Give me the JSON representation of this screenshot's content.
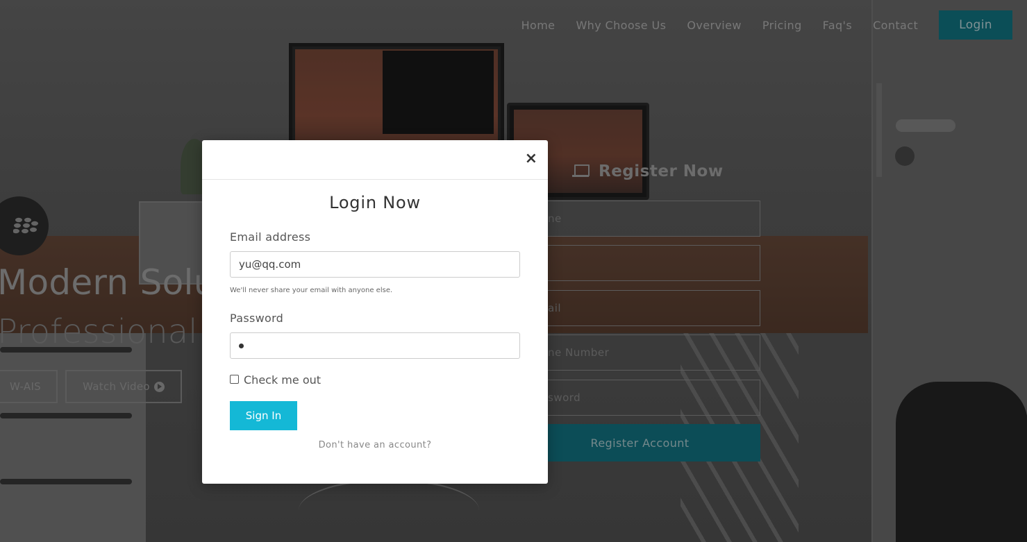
{
  "nav": {
    "items": [
      "Home",
      "Why Choose Us",
      "Overview",
      "Pricing",
      "Faq's",
      "Contact"
    ],
    "login_label": "Login"
  },
  "hero": {
    "title": "Modern Solut",
    "subtitle": "Professional CV",
    "button1_label": "W-AIS",
    "button2_label": "Watch Video"
  },
  "register": {
    "title": "Register Now",
    "fields": [
      "ne",
      "",
      "ail",
      "ne Number",
      "sword"
    ],
    "button_label": "Register Account"
  },
  "modal": {
    "close_symbol": "×",
    "title": "Login Now",
    "email_label": "Email address",
    "email_value": "yu@qq.com",
    "email_help": "We'll never share your email with anyone else.",
    "password_label": "Password",
    "check_label": "Check me out",
    "signin_label": "Sign In",
    "no_account_text": "Don't have an account?"
  },
  "colors": {
    "accent": "#14b8d6",
    "nav_login_bg": "#117986"
  }
}
